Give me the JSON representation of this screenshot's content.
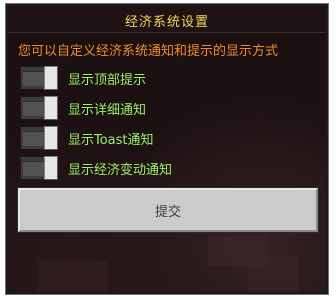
{
  "dialog": {
    "title": "经济系统设置",
    "subtitle": "您可以自定义经济系统通知和提示的显示方式",
    "toggles": [
      {
        "label": "显示顶部提示",
        "state": "off"
      },
      {
        "label": "显示详细通知",
        "state": "off"
      },
      {
        "label": "显示Toast通知",
        "state": "off"
      },
      {
        "label": "显示经济变动通知",
        "state": "off"
      }
    ],
    "submit_label": "提交"
  },
  "colors": {
    "title": "#f3d65a",
    "subtitle": "#f08c2a",
    "toggle_label": "#9cf268",
    "background": "#1a0f11",
    "button": "#cbcbcb"
  }
}
